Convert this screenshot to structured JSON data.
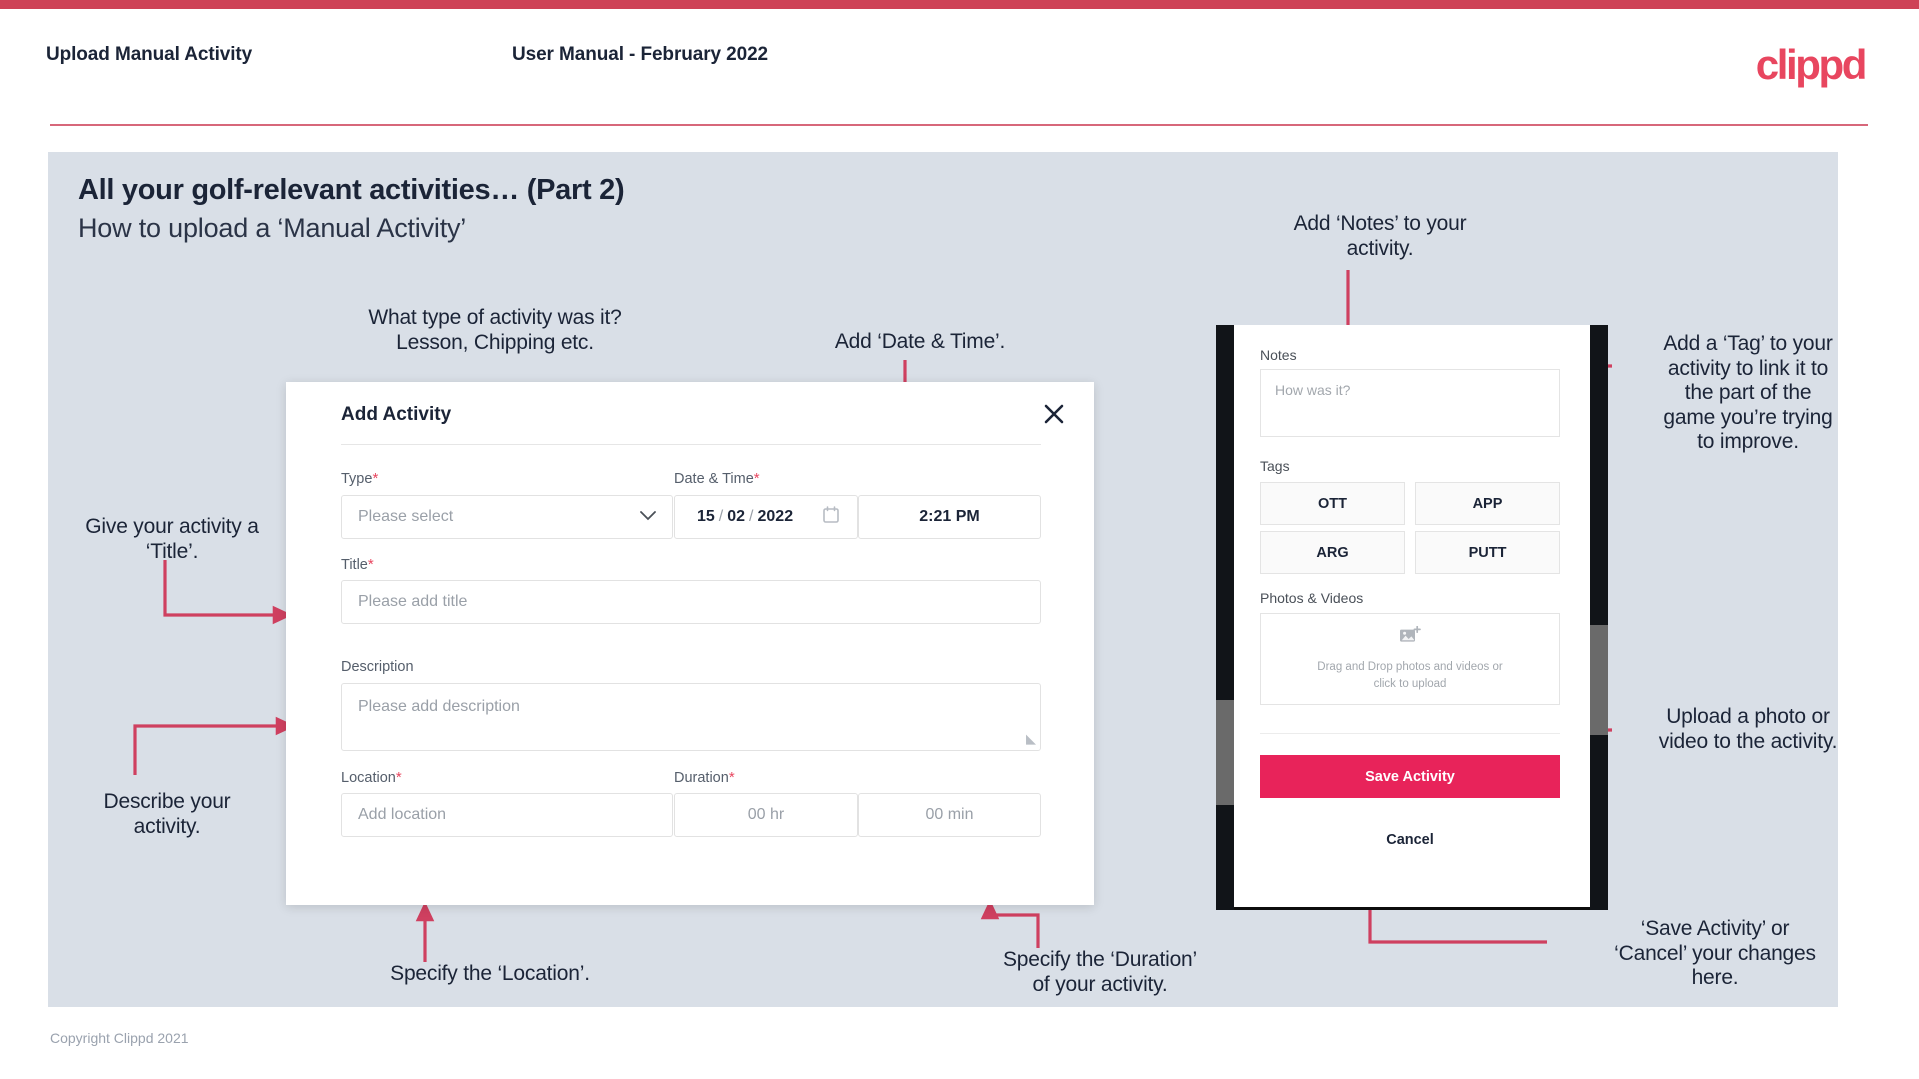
{
  "theme": {
    "accent_pink": "#ce4257",
    "brand_pink": "#e8465f",
    "save_pink": "#e8235a",
    "slide_bg": "#d9dfe7",
    "ink": "#1b2437"
  },
  "header": {
    "title": "Upload Manual Activity",
    "subtitle": "User Manual - February 2022",
    "logo": "clippd"
  },
  "slide": {
    "title": "All your golf-relevant activities… (Part 2)",
    "subtitle": "How to upload a ‘Manual Activity’"
  },
  "footer": {
    "copyright": "Copyright Clippd 2021"
  },
  "callouts": {
    "type": "What type of activity was it?\nLesson, Chipping etc.",
    "datetime": "Add ‘Date & Time’.",
    "title": "Give your activity a\n‘Title’.",
    "description": "Describe your\nactivity.",
    "location": "Specify the ‘Location’.",
    "duration": "Specify the ‘Duration’\nof your activity.",
    "notes": "Add ‘Notes’ to your\nactivity.",
    "tag": "Add a ‘Tag’ to your\nactivity to link it to\nthe part of the\ngame you’re trying\nto improve.",
    "upload": "Upload a photo or\nvideo to the activity.",
    "save_cancel": "‘Save Activity’ or\n‘Cancel’ your changes\nhere."
  },
  "modal": {
    "title": "Add Activity",
    "close_icon": "close-icon",
    "fields": {
      "type": {
        "label": "Type",
        "required": "*",
        "placeholder": "Please select",
        "caret_icon": "chevron-down-icon"
      },
      "datetime": {
        "label": "Date & Time",
        "required": "*",
        "day": "15",
        "sep1": "/",
        "month": "02",
        "sep2": "/",
        "year": "2022",
        "calendar_icon": "calendar-icon",
        "time": "2:21 PM"
      },
      "title": {
        "label": "Title",
        "required": "*",
        "placeholder": "Please add title"
      },
      "description": {
        "label": "Description",
        "placeholder": "Please add description"
      },
      "location": {
        "label": "Location",
        "required": "*",
        "placeholder": "Add location"
      },
      "duration": {
        "label": "Duration",
        "required": "*",
        "hours_placeholder": "00 hr",
        "minutes_placeholder": "00 min"
      }
    }
  },
  "phone": {
    "notes": {
      "label": "Notes",
      "placeholder": "How was it?"
    },
    "tags": {
      "label": "Tags",
      "items": [
        "OTT",
        "APP",
        "ARG",
        "PUTT"
      ]
    },
    "photos": {
      "label": "Photos & Videos",
      "icon": "add-photo-icon",
      "dropzone_text": "Drag and Drop photos and videos or click to upload"
    },
    "actions": {
      "save": "Save Activity",
      "cancel": "Cancel"
    }
  }
}
